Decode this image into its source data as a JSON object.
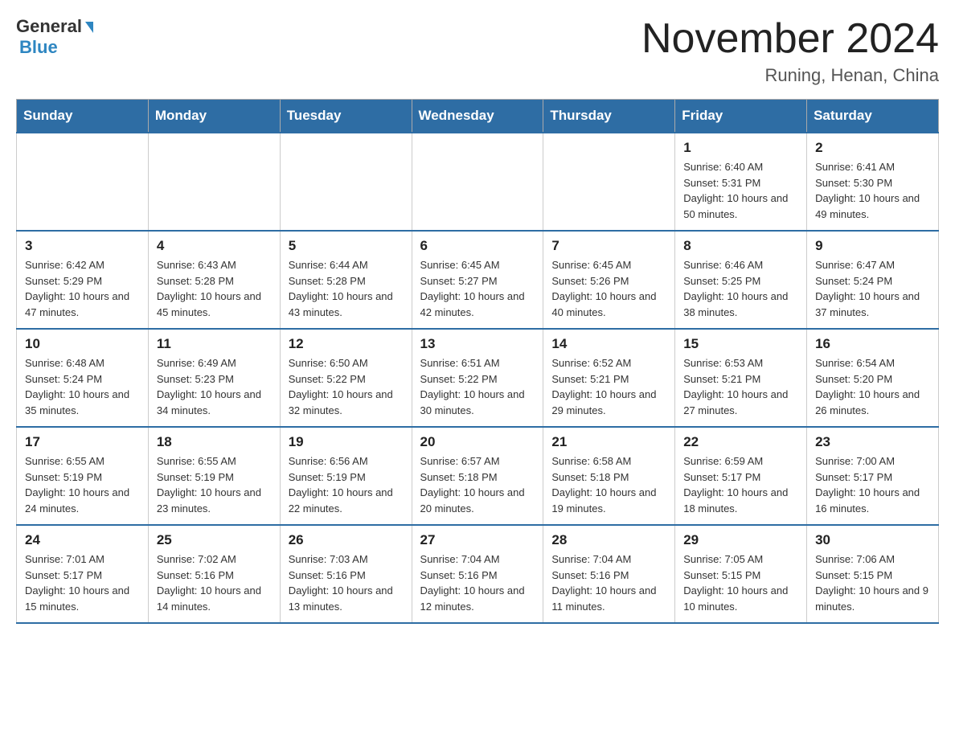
{
  "header": {
    "logo_general": "General",
    "logo_blue": "Blue",
    "month_title": "November 2024",
    "subtitle": "Runing, Henan, China"
  },
  "weekdays": [
    "Sunday",
    "Monday",
    "Tuesday",
    "Wednesday",
    "Thursday",
    "Friday",
    "Saturday"
  ],
  "weeks": [
    [
      {
        "day": "",
        "info": ""
      },
      {
        "day": "",
        "info": ""
      },
      {
        "day": "",
        "info": ""
      },
      {
        "day": "",
        "info": ""
      },
      {
        "day": "",
        "info": ""
      },
      {
        "day": "1",
        "info": "Sunrise: 6:40 AM\nSunset: 5:31 PM\nDaylight: 10 hours and 50 minutes."
      },
      {
        "day": "2",
        "info": "Sunrise: 6:41 AM\nSunset: 5:30 PM\nDaylight: 10 hours and 49 minutes."
      }
    ],
    [
      {
        "day": "3",
        "info": "Sunrise: 6:42 AM\nSunset: 5:29 PM\nDaylight: 10 hours and 47 minutes."
      },
      {
        "day": "4",
        "info": "Sunrise: 6:43 AM\nSunset: 5:28 PM\nDaylight: 10 hours and 45 minutes."
      },
      {
        "day": "5",
        "info": "Sunrise: 6:44 AM\nSunset: 5:28 PM\nDaylight: 10 hours and 43 minutes."
      },
      {
        "day": "6",
        "info": "Sunrise: 6:45 AM\nSunset: 5:27 PM\nDaylight: 10 hours and 42 minutes."
      },
      {
        "day": "7",
        "info": "Sunrise: 6:45 AM\nSunset: 5:26 PM\nDaylight: 10 hours and 40 minutes."
      },
      {
        "day": "8",
        "info": "Sunrise: 6:46 AM\nSunset: 5:25 PM\nDaylight: 10 hours and 38 minutes."
      },
      {
        "day": "9",
        "info": "Sunrise: 6:47 AM\nSunset: 5:24 PM\nDaylight: 10 hours and 37 minutes."
      }
    ],
    [
      {
        "day": "10",
        "info": "Sunrise: 6:48 AM\nSunset: 5:24 PM\nDaylight: 10 hours and 35 minutes."
      },
      {
        "day": "11",
        "info": "Sunrise: 6:49 AM\nSunset: 5:23 PM\nDaylight: 10 hours and 34 minutes."
      },
      {
        "day": "12",
        "info": "Sunrise: 6:50 AM\nSunset: 5:22 PM\nDaylight: 10 hours and 32 minutes."
      },
      {
        "day": "13",
        "info": "Sunrise: 6:51 AM\nSunset: 5:22 PM\nDaylight: 10 hours and 30 minutes."
      },
      {
        "day": "14",
        "info": "Sunrise: 6:52 AM\nSunset: 5:21 PM\nDaylight: 10 hours and 29 minutes."
      },
      {
        "day": "15",
        "info": "Sunrise: 6:53 AM\nSunset: 5:21 PM\nDaylight: 10 hours and 27 minutes."
      },
      {
        "day": "16",
        "info": "Sunrise: 6:54 AM\nSunset: 5:20 PM\nDaylight: 10 hours and 26 minutes."
      }
    ],
    [
      {
        "day": "17",
        "info": "Sunrise: 6:55 AM\nSunset: 5:19 PM\nDaylight: 10 hours and 24 minutes."
      },
      {
        "day": "18",
        "info": "Sunrise: 6:55 AM\nSunset: 5:19 PM\nDaylight: 10 hours and 23 minutes."
      },
      {
        "day": "19",
        "info": "Sunrise: 6:56 AM\nSunset: 5:19 PM\nDaylight: 10 hours and 22 minutes."
      },
      {
        "day": "20",
        "info": "Sunrise: 6:57 AM\nSunset: 5:18 PM\nDaylight: 10 hours and 20 minutes."
      },
      {
        "day": "21",
        "info": "Sunrise: 6:58 AM\nSunset: 5:18 PM\nDaylight: 10 hours and 19 minutes."
      },
      {
        "day": "22",
        "info": "Sunrise: 6:59 AM\nSunset: 5:17 PM\nDaylight: 10 hours and 18 minutes."
      },
      {
        "day": "23",
        "info": "Sunrise: 7:00 AM\nSunset: 5:17 PM\nDaylight: 10 hours and 16 minutes."
      }
    ],
    [
      {
        "day": "24",
        "info": "Sunrise: 7:01 AM\nSunset: 5:17 PM\nDaylight: 10 hours and 15 minutes."
      },
      {
        "day": "25",
        "info": "Sunrise: 7:02 AM\nSunset: 5:16 PM\nDaylight: 10 hours and 14 minutes."
      },
      {
        "day": "26",
        "info": "Sunrise: 7:03 AM\nSunset: 5:16 PM\nDaylight: 10 hours and 13 minutes."
      },
      {
        "day": "27",
        "info": "Sunrise: 7:04 AM\nSunset: 5:16 PM\nDaylight: 10 hours and 12 minutes."
      },
      {
        "day": "28",
        "info": "Sunrise: 7:04 AM\nSunset: 5:16 PM\nDaylight: 10 hours and 11 minutes."
      },
      {
        "day": "29",
        "info": "Sunrise: 7:05 AM\nSunset: 5:15 PM\nDaylight: 10 hours and 10 minutes."
      },
      {
        "day": "30",
        "info": "Sunrise: 7:06 AM\nSunset: 5:15 PM\nDaylight: 10 hours and 9 minutes."
      }
    ]
  ]
}
